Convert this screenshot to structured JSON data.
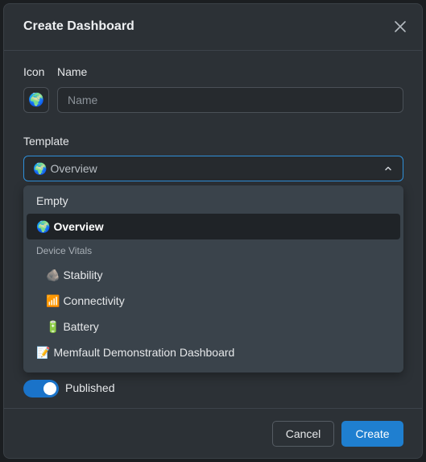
{
  "dialog": {
    "title": "Create Dashboard"
  },
  "form": {
    "icon_label": "Icon",
    "name_label": "Name",
    "icon_emoji": "🌍",
    "name_placeholder": "Name",
    "name_value": "",
    "template_label": "Template",
    "template_selected_emoji": "🌍",
    "template_selected": "Overview"
  },
  "dropdown": {
    "options": [
      {
        "emoji": "",
        "label": "Empty",
        "selected": false
      },
      {
        "emoji": "🌍",
        "label": "Overview",
        "selected": true
      }
    ],
    "group": {
      "label": "Device Vitals",
      "options": [
        {
          "emoji": "🪨",
          "label": "Stability"
        },
        {
          "emoji": "📶",
          "label": "Connectivity"
        },
        {
          "emoji": "🔋",
          "label": "Battery"
        }
      ]
    },
    "trailing": {
      "emoji": "📝",
      "label": "Memfault Demonstration Dashboard"
    }
  },
  "published": {
    "label": "Published",
    "on": true
  },
  "footer": {
    "cancel_label": "Cancel",
    "create_label": "Create"
  },
  "colors": {
    "accent": "#1f7fd0",
    "focus_border": "#2f8fd8",
    "modal_bg": "#2c3136",
    "dropdown_bg": "#3a434b"
  },
  "icons": {
    "close": "close-icon",
    "chevron": "chevron-up-icon"
  }
}
